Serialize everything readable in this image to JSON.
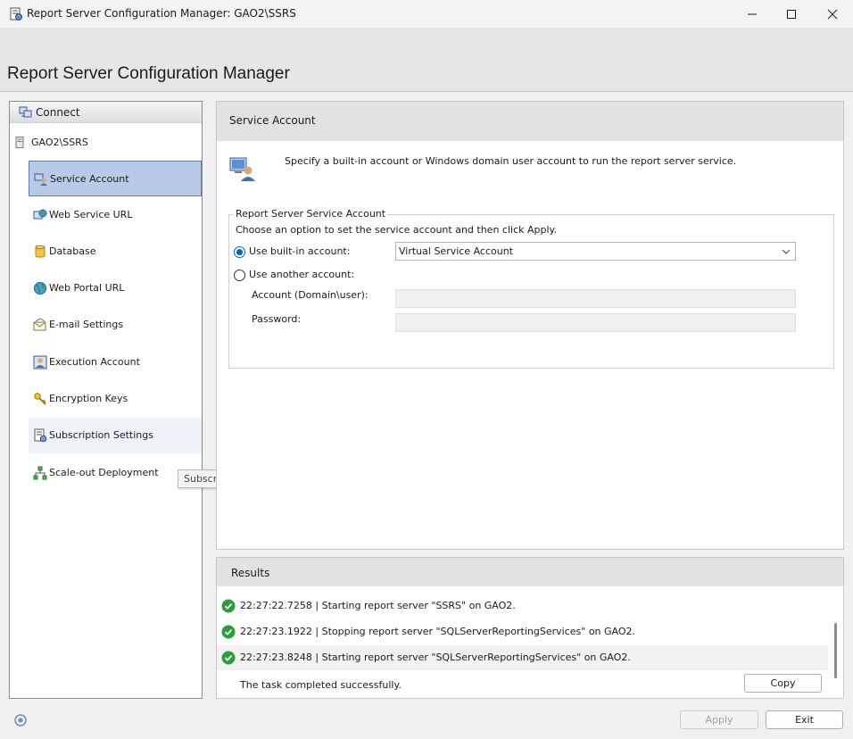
{
  "window": {
    "title": "Report Server Configuration Manager: GAO2\\SSRS",
    "app_title": "Report Server Configuration Manager"
  },
  "nav": {
    "connect_label": "Connect",
    "server_label": "GAO2\\SSRS",
    "items": [
      {
        "label": "Service Account",
        "icon": "service-account-icon",
        "state": "selected"
      },
      {
        "label": "Web Service URL",
        "icon": "web-service-icon"
      },
      {
        "label": "Database",
        "icon": "database-icon"
      },
      {
        "label": "Web Portal URL",
        "icon": "globe-icon"
      },
      {
        "label": "E-mail Settings",
        "icon": "email-icon"
      },
      {
        "label": "Execution Account",
        "icon": "execution-account-icon"
      },
      {
        "label": "Encryption Keys",
        "icon": "keys-icon"
      },
      {
        "label": "Subscription Settings",
        "icon": "subscription-icon",
        "state": "hover"
      },
      {
        "label": "Scale-out Deployment",
        "icon": "scale-out-icon"
      }
    ],
    "tooltip": "Subscription Settings"
  },
  "service_account": {
    "heading": "Service Account",
    "description": "Specify a built-in account or Windows domain user account to run the report server service.",
    "group_label": "Report Server Service Account",
    "instruction": "Choose an option to set the service account and then click Apply.",
    "builtin_radio_label": "Use built-in account:",
    "builtin_selected": true,
    "builtin_value": "Virtual Service Account",
    "another_radio_label": "Use another account:",
    "account_label": "Account (Domain\\user):",
    "account_value": "",
    "password_label": "Password:",
    "password_value": ""
  },
  "results": {
    "heading": "Results",
    "rows": [
      {
        "status": "success",
        "text": "22:27:22.7258 | Starting report server \"SSRS\" on GAO2."
      },
      {
        "status": "success",
        "text": "22:27:23.1922 | Stopping report server \"SQLServerReportingServices\" on GAO2."
      },
      {
        "status": "success",
        "text": "22:27:23.8248 | Starting report server \"SQLServerReportingServices\" on GAO2."
      }
    ],
    "summary": "The task completed successfully.",
    "copy_label": "Copy"
  },
  "footer": {
    "apply_label": "Apply",
    "apply_enabled": false,
    "exit_label": "Exit"
  },
  "colors": {
    "selected_bg": "#b8cae6",
    "selected_border": "#5b7db7",
    "radio_accent": "#0067c0",
    "success_green": "#2a9d3a"
  }
}
